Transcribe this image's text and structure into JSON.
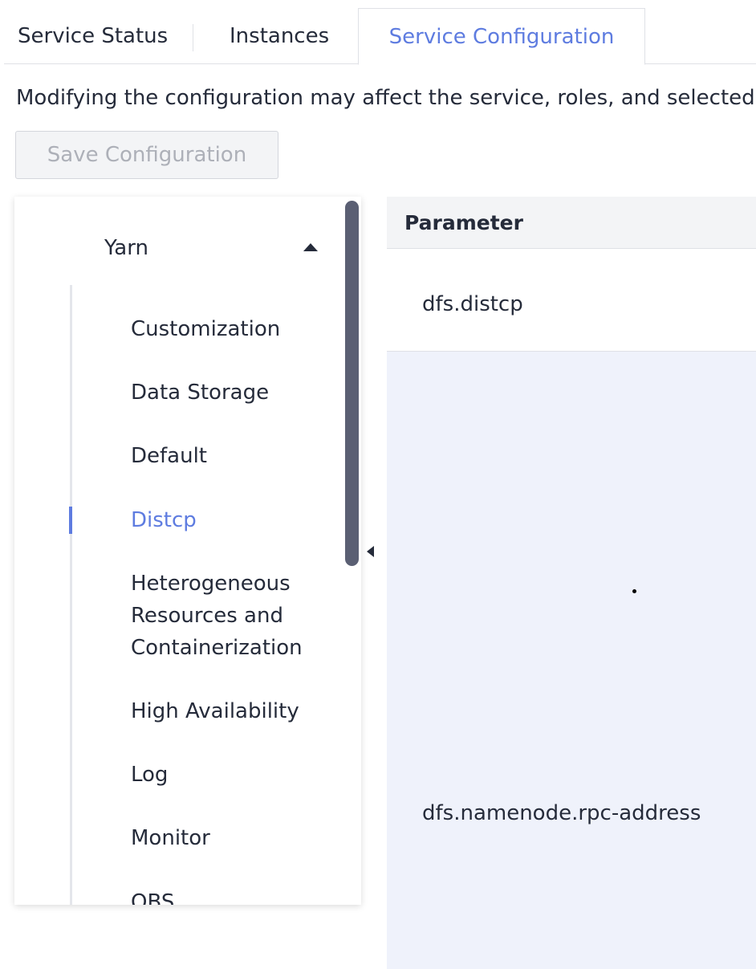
{
  "tabs": [
    {
      "label": "Service Status",
      "active": false
    },
    {
      "label": "Instances",
      "active": false
    },
    {
      "label": "Service Configuration",
      "active": true
    }
  ],
  "notice": "Modifying the configuration may affect the service, roles, and selected host",
  "toolbar": {
    "save_label": "Save Configuration",
    "save_disabled": true
  },
  "tree": {
    "root_label": "Yarn",
    "expanded": true,
    "items": [
      {
        "label": "Customization",
        "active": false
      },
      {
        "label": "Data Storage",
        "active": false
      },
      {
        "label": "Default",
        "active": false
      },
      {
        "label": "Distcp",
        "active": true
      },
      {
        "label": "Heterogeneous Resources and Containerization",
        "active": false
      },
      {
        "label": "High Availability",
        "active": false
      },
      {
        "label": "Log",
        "active": false
      },
      {
        "label": "Monitor",
        "active": false
      },
      {
        "label": "OBS",
        "active": false
      }
    ]
  },
  "table": {
    "columns": [
      "Parameter"
    ],
    "rows": [
      {
        "parameter": "dfs.distcp"
      },
      {
        "parameter": "dfs.namenode.rpc-address"
      }
    ]
  },
  "colors": {
    "accent": "#5e7ce0",
    "text": "#252b3a",
    "border": "#dfe1e6",
    "disabled_bg": "#f3f4f6",
    "disabled_text": "#adb0b8",
    "highlight_row": "#eff2fb",
    "scrollbar": "#5a5f73"
  },
  "icons": {
    "tree_caret": "caret-up-icon",
    "collapse": "caret-left-icon"
  }
}
